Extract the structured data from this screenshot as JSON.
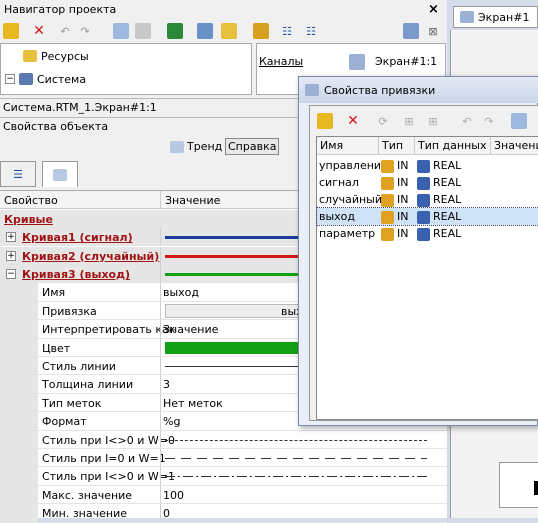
{
  "navigator": {
    "title": "Навигатор проекта",
    "tree": [
      "Ресурсы",
      "Система"
    ],
    "channels_label": "Каналы",
    "screen_item": "Экран#1:1"
  },
  "path": "Система.RTM_1.Экран#1:1",
  "object_props": "Свойства объекта",
  "trend_label": "Тренд",
  "help_label": "Справка",
  "grid": {
    "headers": [
      "Свойство",
      "Значение"
    ],
    "section": "Кривые",
    "curves": [
      {
        "label": "Кривая1 (сигнал)",
        "color": "#1a3c9a"
      },
      {
        "label": "Кривая2 (случайный)",
        "color": "#d01818"
      },
      {
        "label": "Кривая3 (выход)",
        "color": "#14a014"
      }
    ],
    "props": [
      {
        "name": "Имя",
        "value": "выход"
      },
      {
        "name": "Привязка",
        "value": "вых"
      },
      {
        "name": "Интерпретировать как",
        "value": "Значение"
      },
      {
        "name": "Цвет",
        "value": ""
      },
      {
        "name": "Стиль линии",
        "value": ""
      },
      {
        "name": "Толщина линии",
        "value": "3"
      },
      {
        "name": "Тип меток",
        "value": "Нет меток"
      },
      {
        "name": "Формат",
        "value": "%g"
      },
      {
        "name": "Стиль при I<>0 и W=0",
        "value": ""
      },
      {
        "name": "Стиль при I=0 и W=1",
        "value": ""
      },
      {
        "name": "Стиль при I<>0 и W=1",
        "value": ""
      },
      {
        "name": "Макс. значение",
        "value": "100"
      },
      {
        "name": "Мин. значение",
        "value": "0"
      }
    ]
  },
  "screen_tab": "Экран#1",
  "dialog": {
    "title": "Свойства привязки",
    "headers": [
      "Имя",
      "Тип",
      "Тип данных",
      "Значение"
    ],
    "rows": [
      {
        "name": "управление",
        "type": "IN",
        "dtype": "REAL"
      },
      {
        "name": "сигнал",
        "type": "IN",
        "dtype": "REAL"
      },
      {
        "name": "случайный",
        "type": "IN",
        "dtype": "REAL"
      },
      {
        "name": "выход",
        "type": "IN",
        "dtype": "REAL"
      },
      {
        "name": "параметр",
        "type": "IN",
        "dtype": "REAL"
      }
    ]
  },
  "colors": {
    "curve_green": "#14a014",
    "selection": "#cfe3f7"
  }
}
